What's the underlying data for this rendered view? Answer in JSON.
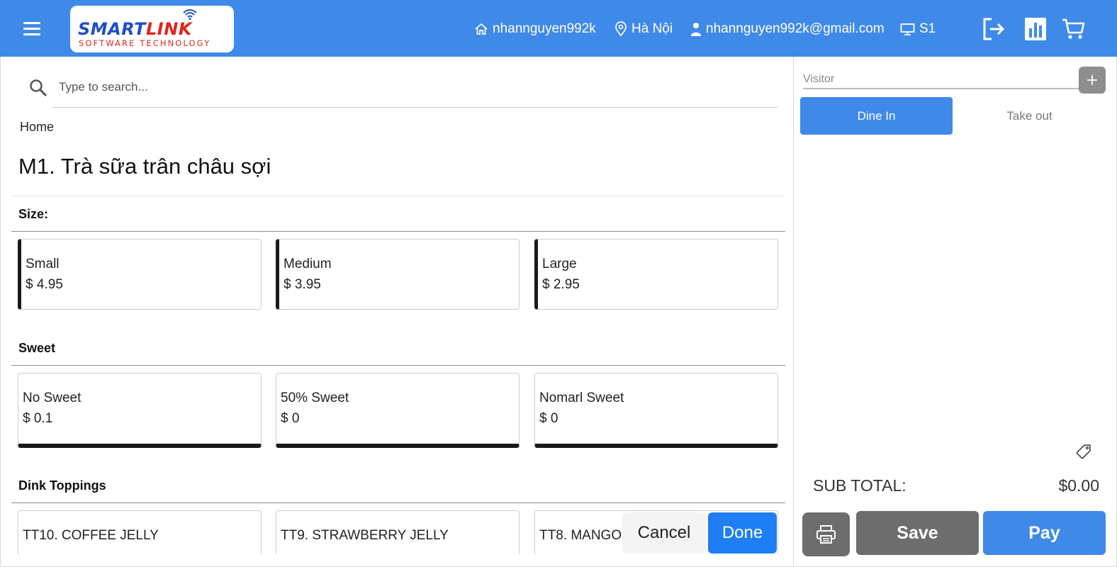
{
  "header": {
    "logo_main_a": "SMART",
    "logo_main_b": "LINK",
    "logo_sub": "SOFTWARE TECHNOLOGY",
    "store": "nhannguyen992k",
    "location": "Hà Nội",
    "email": "nhannguyen992k@gmail.com",
    "station": "S1",
    "icons": [
      "menu-icon",
      "home-icon",
      "location-pin-icon",
      "user-icon",
      "monitor-icon",
      "logout-icon",
      "report-chart-icon",
      "cart-icon"
    ]
  },
  "search": {
    "placeholder": "Type to search..."
  },
  "breadcrumb": "Home",
  "product": {
    "title": "M1. Trà sữa trân châu sợi"
  },
  "groups": [
    {
      "label": "Size:",
      "options": [
        {
          "name": "Small",
          "price": "$ 4.95"
        },
        {
          "name": "Medium",
          "price": "$ 3.95"
        },
        {
          "name": "Large",
          "price": "$ 2.95"
        }
      ]
    },
    {
      "label": "Sweet",
      "options": [
        {
          "name": "No Sweet",
          "price": "$ 0.1"
        },
        {
          "name": "50% Sweet",
          "price": "$ 0"
        },
        {
          "name": "Nomarl Sweet",
          "price": "$ 0"
        }
      ]
    },
    {
      "label": "Dink Toppings",
      "options": [
        {
          "name": "TT10. COFFEE JELLY"
        },
        {
          "name": "TT9. STRAWBERRY JELLY"
        },
        {
          "name": "TT8. MANGO"
        }
      ]
    }
  ],
  "actions": {
    "cancel": "Cancel",
    "done": "Done"
  },
  "cart": {
    "visitor_placeholder": "Visitor",
    "tabs": [
      "Dine In",
      "Take out"
    ],
    "active_tab": "Dine In",
    "subtotal_label": "SUB TOTAL:",
    "subtotal_value": "$0.00",
    "save": "Save",
    "pay": "Pay"
  },
  "colors": {
    "primary": "#3f8ae9",
    "done": "#1f7ef3",
    "secondary": "#6d6d6d",
    "logo_blue": "#1f4fc4",
    "logo_red": "#e1261c"
  }
}
